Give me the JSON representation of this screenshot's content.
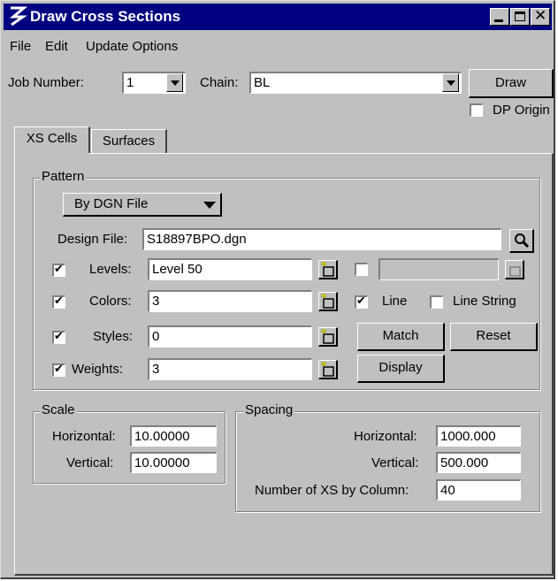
{
  "window": {
    "title": "Draw Cross Sections"
  },
  "menu": {
    "file": "File",
    "edit": "Edit",
    "update_options": "Update Options"
  },
  "header": {
    "job_number_label": "Job Number:",
    "job_number_value": "1",
    "chain_label": "Chain:",
    "chain_value": "BL",
    "draw_button": "Draw",
    "dp_origin_label": "DP Origin",
    "dp_origin_checked": false
  },
  "tabs": [
    {
      "label": "XS Cells",
      "active": true
    },
    {
      "label": "Surfaces",
      "active": false
    }
  ],
  "pattern": {
    "group_label": "Pattern",
    "mode_value": "By DGN File",
    "design_file_label": "Design File:",
    "design_file_value": "S18897BPO.dgn",
    "levels_label": "Levels:",
    "levels_value": "Level 50",
    "levels_checked": true,
    "colors_label": "Colors:",
    "colors_value": "3",
    "colors_checked": true,
    "styles_label": "Styles:",
    "styles_value": "0",
    "styles_checked": true,
    "weights_label": "Weights:",
    "weights_value": "3",
    "weights_checked": true,
    "line_label": "Line",
    "line_checked": true,
    "line_string_label": "Line String",
    "line_string_checked": false,
    "match_button": "Match",
    "reset_button": "Reset",
    "display_button": "Display"
  },
  "scale": {
    "group_label": "Scale",
    "horizontal_label": "Horizontal:",
    "horizontal_value": "10.00000",
    "vertical_label": "Vertical:",
    "vertical_value": "10.00000"
  },
  "spacing": {
    "group_label": "Spacing",
    "horizontal_label": "Horizontal:",
    "horizontal_value": "1000.000",
    "vertical_label": "Vertical:",
    "vertical_value": "500.000",
    "column_label": "Number of XS by Column:",
    "column_value": "40"
  },
  "icons": {
    "app_logo": "app-logo-icon",
    "search": "magnifier-icon",
    "pick": "element-pick-icon"
  },
  "colors": {
    "titlebar": "#000080",
    "face": "#c0c0c0"
  }
}
